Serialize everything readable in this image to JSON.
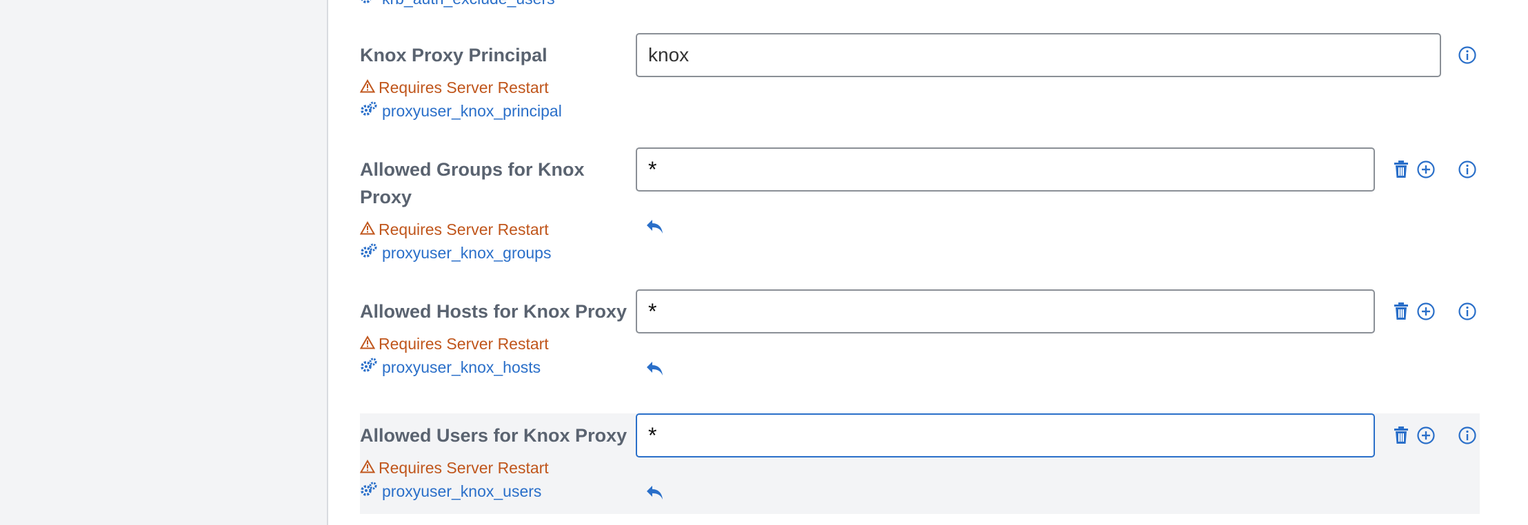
{
  "top_partial_link": "krb_auth_exclude_users",
  "colors": {
    "accent": "#2a6fc9",
    "warning": "#c0561c",
    "label": "#5a6370",
    "border": "#8a8f96",
    "highlight_bg": "#f3f4f6"
  },
  "settings": [
    {
      "label": "Knox Proxy Principal",
      "warning": "Requires Server Restart",
      "key": "proxyuser_knox_principal",
      "value": "knox",
      "actions": [
        "info-icon"
      ]
    },
    {
      "label_line1": "Allowed Groups for Knox",
      "label_line2": "Proxy",
      "warning": "Requires Server Restart",
      "key": "proxyuser_knox_groups",
      "value": "*",
      "actions": [
        "trash-icon",
        "plus-circle-icon",
        "info-icon",
        "undo-icon"
      ]
    },
    {
      "label": "Allowed Hosts for Knox Proxy",
      "warning": "Requires Server Restart",
      "key": "proxyuser_knox_hosts",
      "value": "*",
      "actions": [
        "trash-icon",
        "plus-circle-icon",
        "info-icon",
        "undo-icon"
      ]
    },
    {
      "label": "Allowed Users for Knox Proxy",
      "warning": "Requires Server Restart",
      "key": "proxyuser_knox_users",
      "value": "*",
      "actions": [
        "trash-icon",
        "plus-circle-icon",
        "info-icon",
        "undo-icon"
      ]
    }
  ]
}
